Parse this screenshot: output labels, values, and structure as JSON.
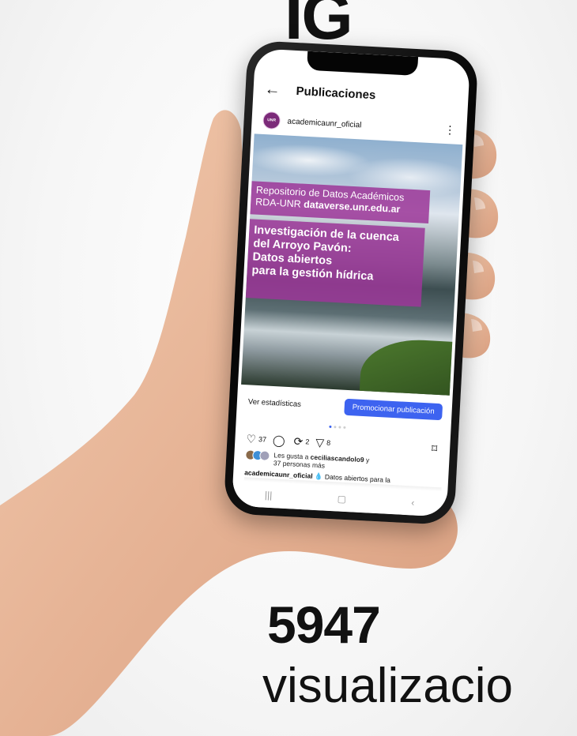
{
  "top_title": "IG",
  "app": {
    "title": "Publicaciones",
    "username": "academicaunr_oficial",
    "avatar_text": "UNR"
  },
  "post_image": {
    "band1_line1": "Repositorio de Datos Académicos",
    "band1_line2_prefix": "RDA-UNR",
    "band1_line2_bold": "dataverse.unr.edu.ar",
    "band2_line1": "Investigación de la cuenca",
    "band2_line2": "del Arroyo Pavón:",
    "band2_line3": "Datos abiertos",
    "band2_line4": "para la gestión hídrica"
  },
  "actions": {
    "stats_label": "Ver estadísticas",
    "promote_label": "Promocionar publicación",
    "likes": "37",
    "comments": "",
    "reposts": "2",
    "shares": "8"
  },
  "likes_line": {
    "prefix": "Les gusta a",
    "user": "ceciliascandolo9",
    "suffix": "y",
    "line2": "37 personas más"
  },
  "caption": {
    "user": "academicaunr_oficial",
    "text": "💧 Datos abiertos para la"
  },
  "bottom_number": "5947",
  "bottom_word": "visualizacio",
  "colors": {
    "accent": "#3d63f0",
    "band": "#9c3798"
  }
}
